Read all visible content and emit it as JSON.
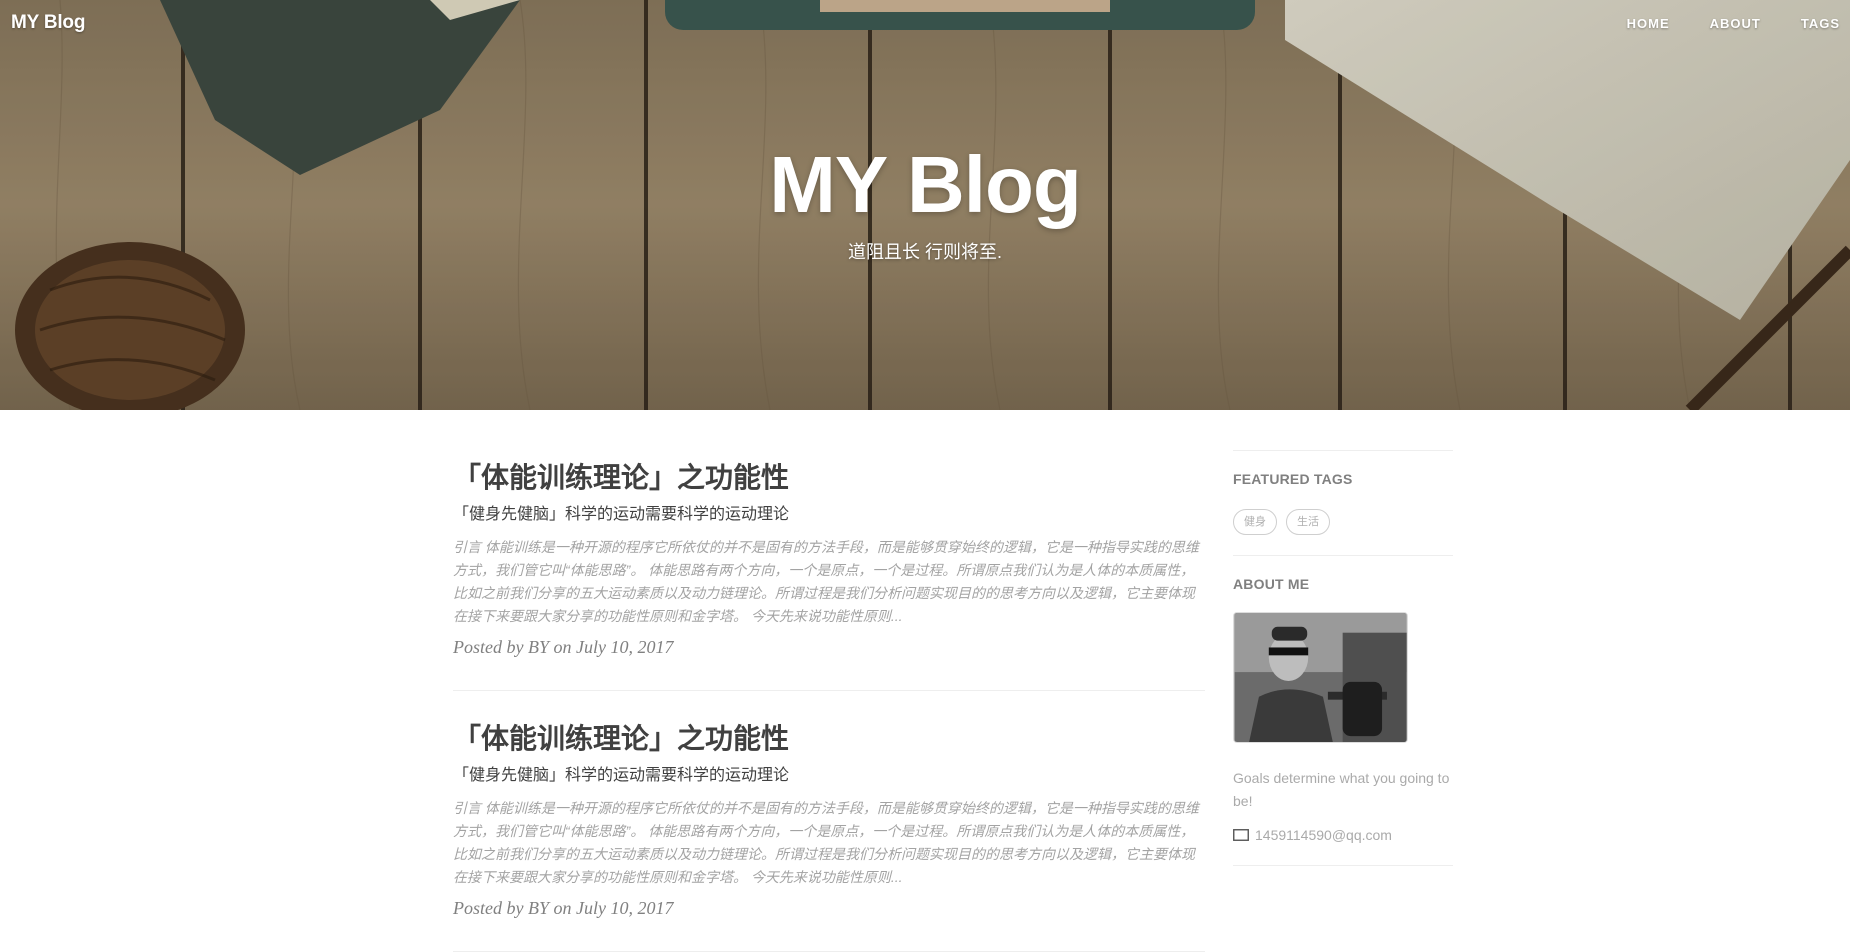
{
  "nav": {
    "brand": "MY Blog",
    "links": [
      "HOME",
      "ABOUT",
      "TAGS"
    ]
  },
  "hero": {
    "title": "MY Blog",
    "subtitle": "道阻且长 行则将至."
  },
  "posts": [
    {
      "title": "「体能训练理论」之功能性",
      "subtitle": "「健身先健脑」科学的运动需要科学的运动理论",
      "excerpt": "引言 体能训练是一种开源的程序它所依仗的并不是固有的方法手段，而是能够贯穿始终的逻辑，它是一种指导实践的思维方式，我们管它叫“体能思路”。 体能思路有两个方向，一个是原点，一个是过程。所谓原点我们认为是人体的本质属性，比如之前我们分享的五大运动素质以及动力链理论。所谓过程是我们分析问题实现目的的思考方向以及逻辑，它主要体现在接下来要跟大家分享的功能性原则和金字塔。 今天先来说功能性原则...",
      "meta": "Posted by BY on July 10, 2017"
    },
    {
      "title": "「体能训练理论」之功能性",
      "subtitle": "「健身先健脑」科学的运动需要科学的运动理论",
      "excerpt": "引言 体能训练是一种开源的程序它所依仗的并不是固有的方法手段，而是能够贯穿始终的逻辑，它是一种指导实践的思维方式，我们管它叫“体能思路”。 体能思路有两个方向，一个是原点，一个是过程。所谓原点我们认为是人体的本质属性，比如之前我们分享的五大运动素质以及动力链理论。所谓过程是我们分析问题实现目的的思考方向以及逻辑，它主要体现在接下来要跟大家分享的功能性原则和金字塔。 今天先来说功能性原则...",
      "meta": "Posted by BY on July 10, 2017"
    }
  ],
  "sidebar": {
    "featured_heading": "FEATURED TAGS",
    "tags": [
      "健身",
      "生活"
    ],
    "about_heading": "ABOUT ME",
    "about_text": "Goals determine what you going to be!",
    "email": "1459114590@qq.com"
  },
  "colors": {
    "heading": "#404040",
    "muted": "#a3a3a3",
    "hero_wood": "#8e7c63"
  },
  "icons": {
    "email": "envelope-icon"
  }
}
